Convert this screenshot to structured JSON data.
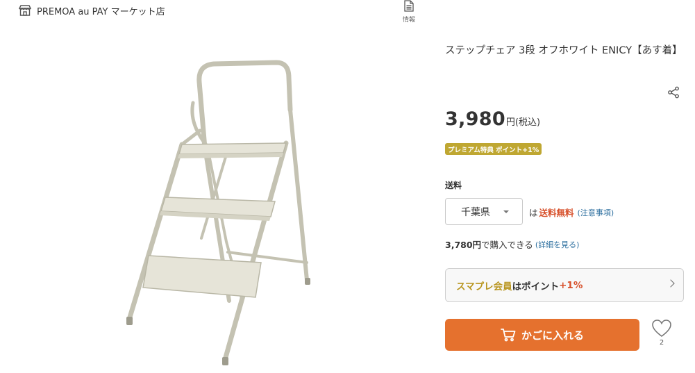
{
  "shop": {
    "name": "PREMOA au PAY マーケット店",
    "icon": "store-icon"
  },
  "info_tab": {
    "label": "情報",
    "icon": "document-icon"
  },
  "product": {
    "title": "ステップチェア 3段 オフホワイト ENICY【あす着】",
    "image_alt": "step-chair-image"
  },
  "share": {
    "icon": "share-icon"
  },
  "price": {
    "value": "3,980",
    "unit": "円(税込)"
  },
  "premium_badge": {
    "label": "プレミアム特典 ポイント+1%",
    "color": "#bfa732"
  },
  "shipping": {
    "label": "送料",
    "prefecture": "千葉県",
    "ha": "は",
    "free_label": "送料無料",
    "note": "(注意事項)"
  },
  "coupon": {
    "price": "3,780円",
    "text": "で購入できる",
    "detail": "(詳細を見る)"
  },
  "membership": {
    "name": "スマプレ会員",
    "ha": "は",
    "point": "ポイント",
    "bonus": "+1%"
  },
  "cart_button": {
    "label": "かごに入れる",
    "color": "#e5712e"
  },
  "favorite": {
    "count": "2",
    "icon": "heart-icon"
  }
}
